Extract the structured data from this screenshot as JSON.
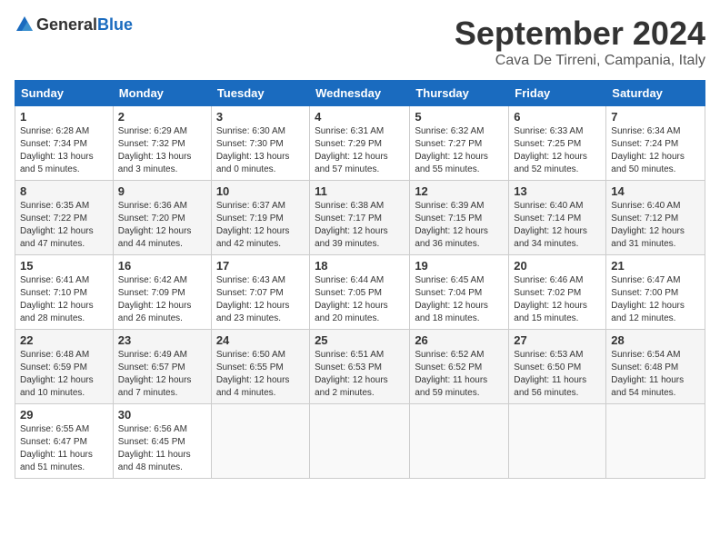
{
  "header": {
    "logo_general": "General",
    "logo_blue": "Blue",
    "month_title": "September 2024",
    "location": "Cava De Tirreni, Campania, Italy"
  },
  "weekdays": [
    "Sunday",
    "Monday",
    "Tuesday",
    "Wednesday",
    "Thursday",
    "Friday",
    "Saturday"
  ],
  "rows": [
    [
      {
        "day": "1",
        "info": "Sunrise: 6:28 AM\nSunset: 7:34 PM\nDaylight: 13 hours\nand 5 minutes."
      },
      {
        "day": "2",
        "info": "Sunrise: 6:29 AM\nSunset: 7:32 PM\nDaylight: 13 hours\nand 3 minutes."
      },
      {
        "day": "3",
        "info": "Sunrise: 6:30 AM\nSunset: 7:30 PM\nDaylight: 13 hours\nand 0 minutes."
      },
      {
        "day": "4",
        "info": "Sunrise: 6:31 AM\nSunset: 7:29 PM\nDaylight: 12 hours\nand 57 minutes."
      },
      {
        "day": "5",
        "info": "Sunrise: 6:32 AM\nSunset: 7:27 PM\nDaylight: 12 hours\nand 55 minutes."
      },
      {
        "day": "6",
        "info": "Sunrise: 6:33 AM\nSunset: 7:25 PM\nDaylight: 12 hours\nand 52 minutes."
      },
      {
        "day": "7",
        "info": "Sunrise: 6:34 AM\nSunset: 7:24 PM\nDaylight: 12 hours\nand 50 minutes."
      }
    ],
    [
      {
        "day": "8",
        "info": "Sunrise: 6:35 AM\nSunset: 7:22 PM\nDaylight: 12 hours\nand 47 minutes."
      },
      {
        "day": "9",
        "info": "Sunrise: 6:36 AM\nSunset: 7:20 PM\nDaylight: 12 hours\nand 44 minutes."
      },
      {
        "day": "10",
        "info": "Sunrise: 6:37 AM\nSunset: 7:19 PM\nDaylight: 12 hours\nand 42 minutes."
      },
      {
        "day": "11",
        "info": "Sunrise: 6:38 AM\nSunset: 7:17 PM\nDaylight: 12 hours\nand 39 minutes."
      },
      {
        "day": "12",
        "info": "Sunrise: 6:39 AM\nSunset: 7:15 PM\nDaylight: 12 hours\nand 36 minutes."
      },
      {
        "day": "13",
        "info": "Sunrise: 6:40 AM\nSunset: 7:14 PM\nDaylight: 12 hours\nand 34 minutes."
      },
      {
        "day": "14",
        "info": "Sunrise: 6:40 AM\nSunset: 7:12 PM\nDaylight: 12 hours\nand 31 minutes."
      }
    ],
    [
      {
        "day": "15",
        "info": "Sunrise: 6:41 AM\nSunset: 7:10 PM\nDaylight: 12 hours\nand 28 minutes."
      },
      {
        "day": "16",
        "info": "Sunrise: 6:42 AM\nSunset: 7:09 PM\nDaylight: 12 hours\nand 26 minutes."
      },
      {
        "day": "17",
        "info": "Sunrise: 6:43 AM\nSunset: 7:07 PM\nDaylight: 12 hours\nand 23 minutes."
      },
      {
        "day": "18",
        "info": "Sunrise: 6:44 AM\nSunset: 7:05 PM\nDaylight: 12 hours\nand 20 minutes."
      },
      {
        "day": "19",
        "info": "Sunrise: 6:45 AM\nSunset: 7:04 PM\nDaylight: 12 hours\nand 18 minutes."
      },
      {
        "day": "20",
        "info": "Sunrise: 6:46 AM\nSunset: 7:02 PM\nDaylight: 12 hours\nand 15 minutes."
      },
      {
        "day": "21",
        "info": "Sunrise: 6:47 AM\nSunset: 7:00 PM\nDaylight: 12 hours\nand 12 minutes."
      }
    ],
    [
      {
        "day": "22",
        "info": "Sunrise: 6:48 AM\nSunset: 6:59 PM\nDaylight: 12 hours\nand 10 minutes."
      },
      {
        "day": "23",
        "info": "Sunrise: 6:49 AM\nSunset: 6:57 PM\nDaylight: 12 hours\nand 7 minutes."
      },
      {
        "day": "24",
        "info": "Sunrise: 6:50 AM\nSunset: 6:55 PM\nDaylight: 12 hours\nand 4 minutes."
      },
      {
        "day": "25",
        "info": "Sunrise: 6:51 AM\nSunset: 6:53 PM\nDaylight: 12 hours\nand 2 minutes."
      },
      {
        "day": "26",
        "info": "Sunrise: 6:52 AM\nSunset: 6:52 PM\nDaylight: 11 hours\nand 59 minutes."
      },
      {
        "day": "27",
        "info": "Sunrise: 6:53 AM\nSunset: 6:50 PM\nDaylight: 11 hours\nand 56 minutes."
      },
      {
        "day": "28",
        "info": "Sunrise: 6:54 AM\nSunset: 6:48 PM\nDaylight: 11 hours\nand 54 minutes."
      }
    ],
    [
      {
        "day": "29",
        "info": "Sunrise: 6:55 AM\nSunset: 6:47 PM\nDaylight: 11 hours\nand 51 minutes."
      },
      {
        "day": "30",
        "info": "Sunrise: 6:56 AM\nSunset: 6:45 PM\nDaylight: 11 hours\nand 48 minutes."
      },
      {
        "day": "",
        "info": ""
      },
      {
        "day": "",
        "info": ""
      },
      {
        "day": "",
        "info": ""
      },
      {
        "day": "",
        "info": ""
      },
      {
        "day": "",
        "info": ""
      }
    ]
  ]
}
